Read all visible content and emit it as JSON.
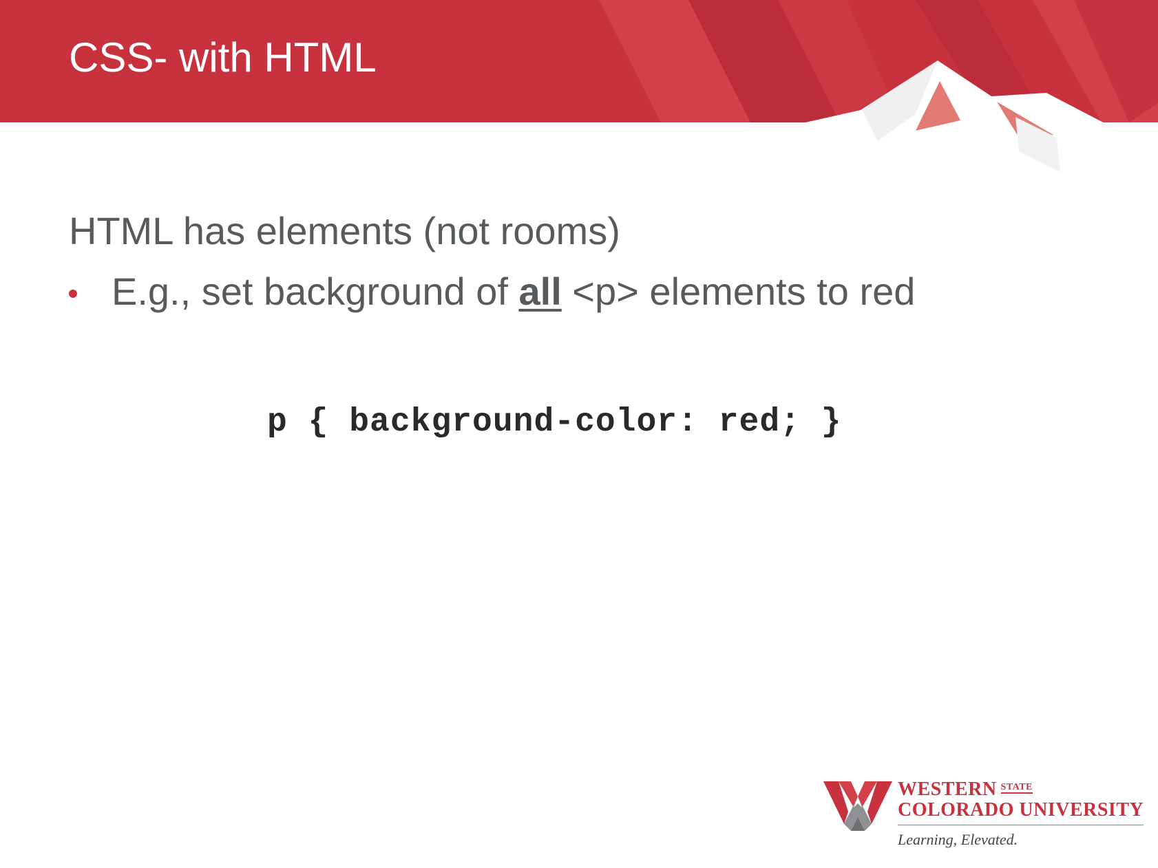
{
  "slide": {
    "title": "CSS- with HTML",
    "heading": "HTML has elements (not rooms)",
    "bullet": {
      "prefix": "E.g., set background of ",
      "emphasis": "all",
      "suffix": " <p> elements to red"
    },
    "code": "p { background-color: red; }"
  },
  "logo": {
    "line1": "WESTERN",
    "line1_small": "STATE",
    "line2": "COLORADO UNIVERSITY",
    "tagline": "Learning, Elevated."
  },
  "colors": {
    "brand_red": "#c8323f",
    "text_gray": "#575b5e"
  }
}
